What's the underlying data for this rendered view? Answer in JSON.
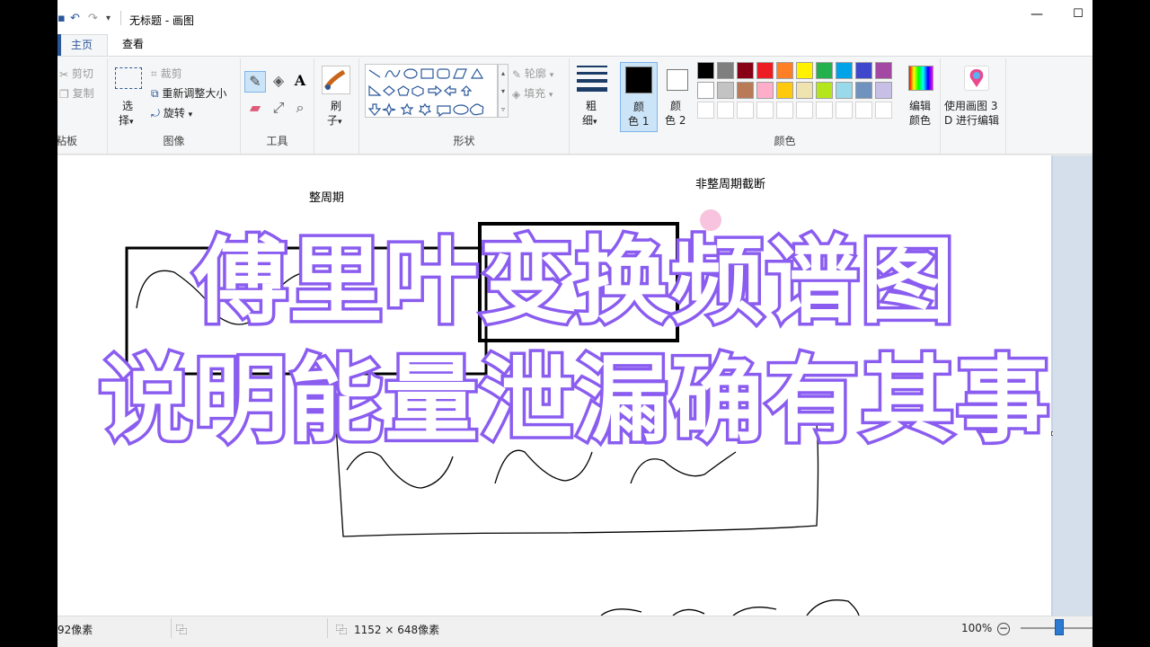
{
  "window": {
    "title": "无标题 - 画图",
    "min_glyph": "—",
    "max_glyph": "☐"
  },
  "tabs": [
    {
      "label": "主页"
    },
    {
      "label": "查看"
    }
  ],
  "ribbon": {
    "clipboard": {
      "cut": "剪切",
      "copy": "复制",
      "group": "粘板"
    },
    "image": {
      "select": "选",
      "select2": "择",
      "crop": "裁剪",
      "resize": "重新调整大小",
      "rotate": "旋转",
      "group": "图像"
    },
    "tools": {
      "group": "工具",
      "text_glyph": "A"
    },
    "brushes": {
      "label1": "刷",
      "label2": "子"
    },
    "shapes": {
      "outline": "轮廓",
      "fill": "填充",
      "group": "形状"
    },
    "size": {
      "label1": "粗",
      "label2": "细"
    },
    "color1": {
      "label1": "颜",
      "label2": "色 1"
    },
    "color2": {
      "label1": "颜",
      "label2": "色 2"
    },
    "edit_colors": {
      "label1": "编辑",
      "label2": "颜色"
    },
    "paint3d": {
      "label1": "使用画图 3",
      "label2": "D 进行编辑"
    },
    "colors_group": "颜色",
    "palette_row1": [
      "#000000",
      "#7f7f7f",
      "#880015",
      "#ed1c24",
      "#ff7f27",
      "#fff200",
      "#22b14c",
      "#00a2e8",
      "#3f48cc",
      "#a349a4"
    ],
    "palette_row2": [
      "#ffffff",
      "#c3c3c3",
      "#b97a57",
      "#ffaec9",
      "#ffc90e",
      "#efe4b0",
      "#b5e61d",
      "#99d9ea",
      "#7092be",
      "#c8bfe7"
    ]
  },
  "canvas": {
    "label_left": "整周期",
    "label_right": "非整周期截断"
  },
  "overlay": {
    "line1": "傅里叶变换频谱图",
    "line2": "说明能量泄漏确有其事"
  },
  "status": {
    "cursor_pos": "92像素",
    "selection_size": "",
    "canvas_size": "1152 × 648像素",
    "zoom": "100%"
  }
}
